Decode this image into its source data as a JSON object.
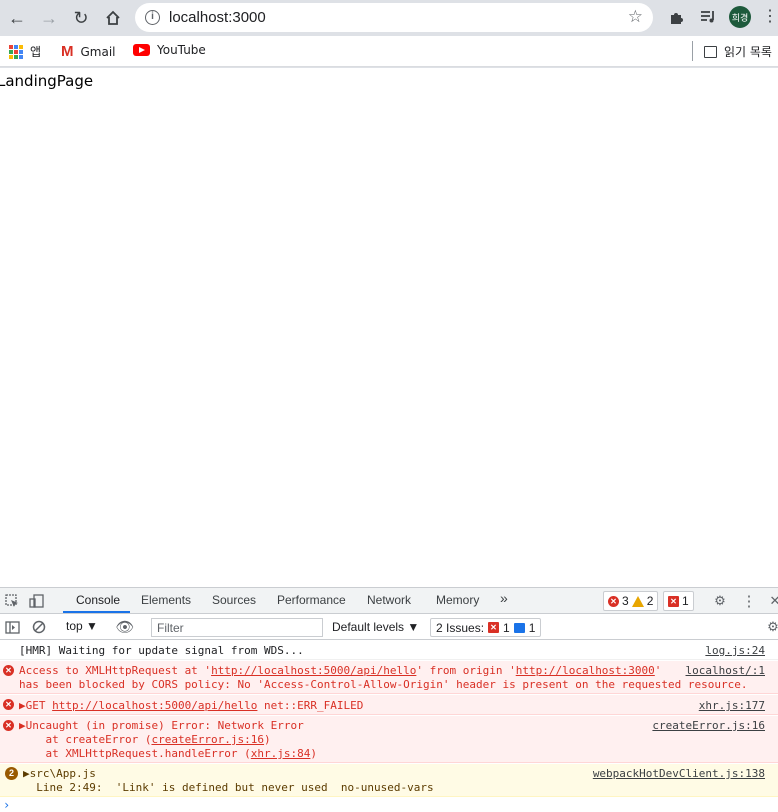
{
  "browser": {
    "url": "localhost:3000",
    "avatar_text": "희경",
    "bookmarks": [
      {
        "label": "앱",
        "icon": "apps-grid-icon"
      },
      {
        "label": "Gmail",
        "icon": "gmail-icon"
      },
      {
        "label": "YouTube",
        "icon": "youtube-icon"
      }
    ],
    "reading_list_label": "읽기 목록"
  },
  "page": {
    "text": "LandingPage"
  },
  "devtools": {
    "tabs": [
      "Console",
      "Elements",
      "Sources",
      "Performance",
      "Network",
      "Memory"
    ],
    "more_tabs": "»",
    "error_count": "3",
    "warning_count": "2",
    "issue_badge_count": "1",
    "context": "top ▼",
    "filter_placeholder": "Filter",
    "levels": "Default levels ▼",
    "issues_label": "2 Issues:",
    "issues_error_count": "1",
    "issues_info_count": "1",
    "messages": [
      {
        "type": "log",
        "text": "[HMR] Waiting for update signal from WDS...",
        "source": "log.js:24"
      },
      {
        "type": "error",
        "line1_pre": "Access to XMLHttpRequest at '",
        "line1_link": "http://localhost:5000/api/hello",
        "line1_mid": "' from origin '",
        "line1_link2": "http://localhost:3000",
        "line1_post": "'",
        "line2": "has been blocked by CORS policy: No 'Access-Control-Allow-Origin' header is present on the requested resource.",
        "source": "localhost/:1"
      },
      {
        "type": "error",
        "prefix": "▶GET ",
        "link": "http://localhost:5000/api/hello",
        "post": " net::ERR_FAILED",
        "source": "xhr.js:177"
      },
      {
        "type": "error",
        "line1": "▶Uncaught (in promise) Error: Network Error",
        "line2_pre": "    at createError (",
        "line2_link": "createError.js:16",
        "line2_post": ")",
        "line3_pre": "    at XMLHttpRequest.handleError (",
        "line3_link": "xhr.js:84",
        "line3_post": ")",
        "source": "createError.js:16"
      },
      {
        "type": "warning",
        "badge": "2",
        "line1": "▶src\\App.js",
        "line2": "  Line 2:49:  'Link' is defined but never used  no-unused-vars",
        "source": "webpackHotDevClient.js:138"
      }
    ],
    "prompt": "›"
  }
}
